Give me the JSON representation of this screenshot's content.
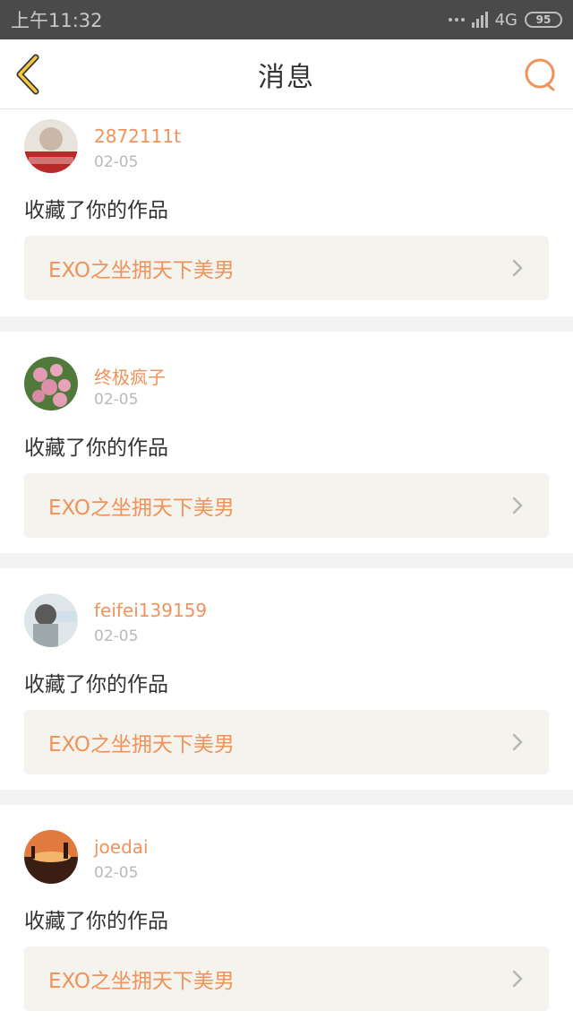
{
  "status_bar": {
    "time": "上午11:32",
    "network": "4G",
    "battery": "95"
  },
  "header": {
    "title": "消息",
    "back_icon": "chevron-left-icon",
    "search_icon": "search-icon"
  },
  "messages": [
    {
      "username": "2872111t",
      "date": "02-05",
      "action": "收藏了你的作品",
      "work_title": "EXO之坐拥天下美男"
    },
    {
      "username": "终极疯子",
      "date": "02-05",
      "action": "收藏了你的作品",
      "work_title": "EXO之坐拥天下美男"
    },
    {
      "username": "feifei139159",
      "date": "02-05",
      "action": "收藏了你的作品",
      "work_title": "EXO之坐拥天下美男"
    },
    {
      "username": "joedai",
      "date": "02-05",
      "action": "收藏了你的作品",
      "work_title": "EXO之坐拥天下美男"
    }
  ],
  "colors": {
    "accent": "#f0935a",
    "back_yellow": "#f5c842",
    "statusbar": "#4a4a4a"
  }
}
